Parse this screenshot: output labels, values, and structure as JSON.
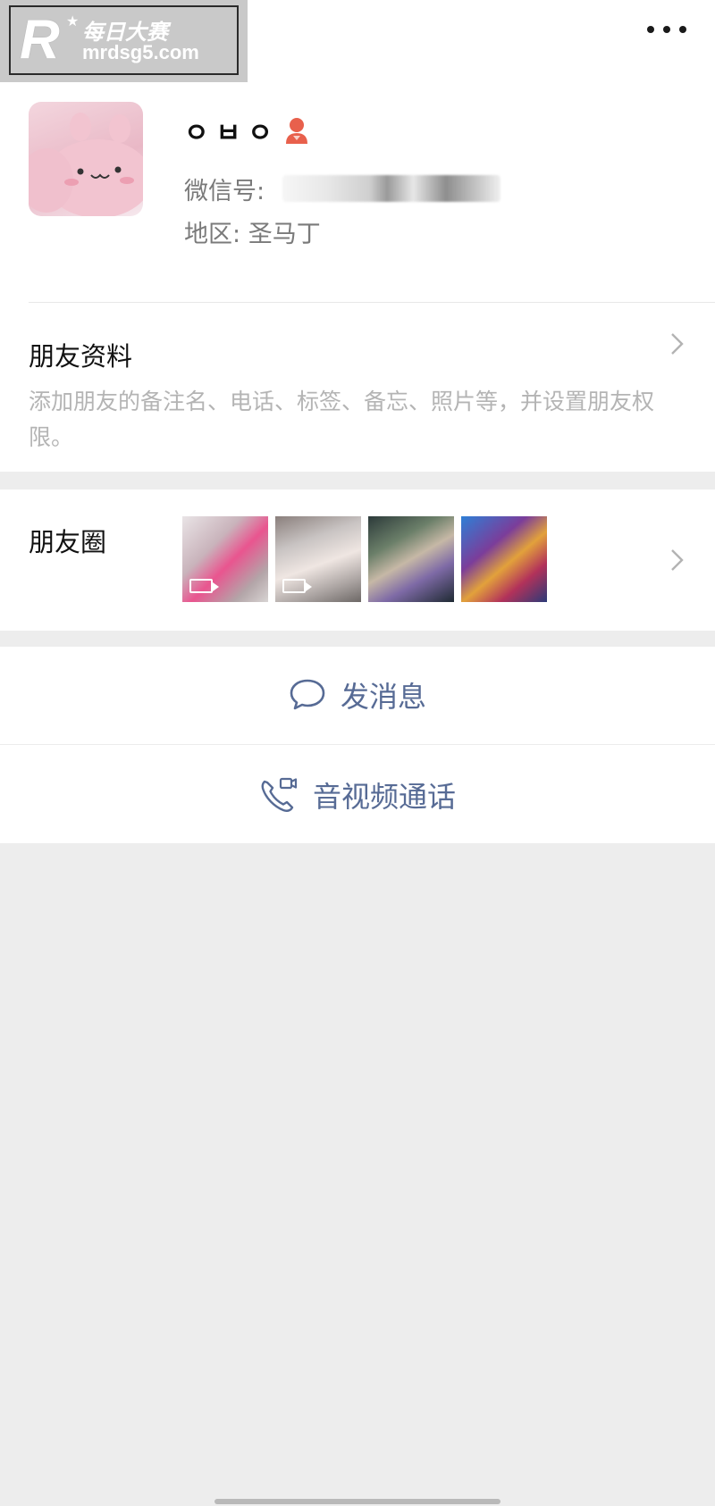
{
  "watermark": {
    "brand_cn": "每日大赛",
    "domain": "mrdsg5.com"
  },
  "header": {
    "more_icon": "more-horizontal-icon"
  },
  "profile": {
    "nickname": "ㅇㅂㅇ",
    "wechat_id_label": "微信号:",
    "region_label": "地区:",
    "region_value": "圣马丁",
    "gender_icon": "female-person-icon"
  },
  "friend_info": {
    "title": "朋友资料",
    "description": "添加朋友的备注名、电话、标签、备忘、照片等，并设置朋友权限。"
  },
  "moments": {
    "title": "朋友圈",
    "thumbnails": [
      {
        "name": "moment-thumb-1",
        "video": true
      },
      {
        "name": "moment-thumb-2",
        "video": true
      },
      {
        "name": "moment-thumb-3",
        "video": false
      },
      {
        "name": "moment-thumb-4",
        "video": false
      }
    ]
  },
  "actions": {
    "send_message": "发消息",
    "av_call": "音视频通话"
  },
  "colors": {
    "link_blue": "#576b95",
    "page_bg": "#ededed",
    "card_bg": "#ffffff",
    "secondary_text": "#7a7a7a",
    "desc_text": "#b4b4b4",
    "gender_icon": "#e8604c"
  }
}
